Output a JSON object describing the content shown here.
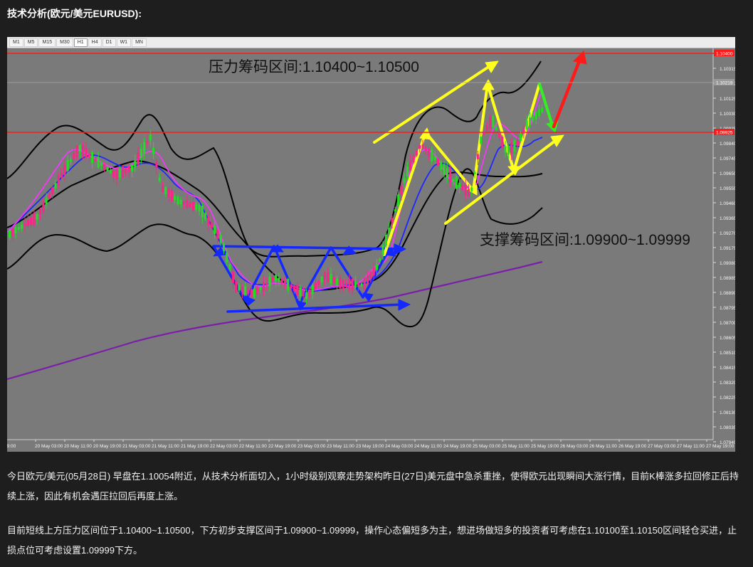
{
  "page": {
    "title": "技术分析(欧元/美元EURUSD):"
  },
  "toolbar": {
    "timeframes": [
      "M1",
      "M5",
      "M15",
      "M30",
      "H1",
      "H4",
      "D1",
      "W1",
      "MN"
    ],
    "active": "H1"
  },
  "chart": {
    "resistance_label": "压力筹码区间:1.10400~1.10500",
    "support_label": "支撑筹码区间:1.09900~1.09999",
    "price_ticks": [
      "1.10315",
      "1.10219",
      "1.10125",
      "1.10030",
      "1.09935",
      "1.09840",
      "1.09745",
      "1.09650",
      "1.09555",
      "1.09460",
      "1.09365",
      "1.09270",
      "1.09175",
      "1.09080",
      "1.08985",
      "1.08890",
      "1.08795",
      "1.08700",
      "1.08605",
      "1.08510",
      "1.08415",
      "1.08320",
      "1.08225",
      "1.08130",
      "1.08035",
      "1.07940"
    ],
    "price_markers": [
      "1.10400",
      "1.10219",
      "1.09925"
    ],
    "time_ticks": [
      "19:00",
      "20 May 03:00",
      "20 May 11:00",
      "20 May 19:00",
      "21 May 03:00",
      "21 May 11:00",
      "21 May 19:00",
      "22 May 03:00",
      "22 May 11:00",
      "22 May 19:00",
      "23 May 03:00",
      "23 May 11:00",
      "23 May 19:00",
      "24 May 03:00",
      "24 May 11:00",
      "24 May 19:00",
      "25 May 03:00",
      "25 May 11:00",
      "25 May 19:00",
      "26 May 03:00",
      "26 May 11:00",
      "26 May 19:00",
      "27 May 03:00",
      "27 May 11:00",
      "27 May 19:00",
      "28 May 03:00"
    ],
    "colors": {
      "background": "#7a7a7a",
      "resistance_line": "#ff1a1a",
      "blue_pattern": "#1428ff",
      "yellow_pattern": "#ffff1e",
      "green_arrow": "#33ee22",
      "red_arrow": "#ff1a1a",
      "bull_candle": "#22dd22",
      "bear_candle": "#ff2288",
      "ma_fast": "#ff33ff",
      "ma_mid": "#1e28ff",
      "bollinger": "#000000",
      "ma_long": "#7a1fa8"
    }
  },
  "paragraphs": [
    "今日欧元/美元(05月28日) 早盘在1.10054附近，从技术分析面切入，1小时级别观察走势架构昨日(27日)美元盘中急杀重挫，使得欧元出现瞬间大涨行情，目前K棒涨多拉回修正后持续上涨，因此有机会遇压拉回后再度上涨。",
    "目前短线上方压力区间位于1.10400~1.10500，下方初步支撑区间于1.09900~1.09999，操作心态偏短多为主，想进场做短多的投资者可考虑在1.10100至1.10150区间轻仓买进，止损点位可考虑设置1.09999下方。"
  ]
}
